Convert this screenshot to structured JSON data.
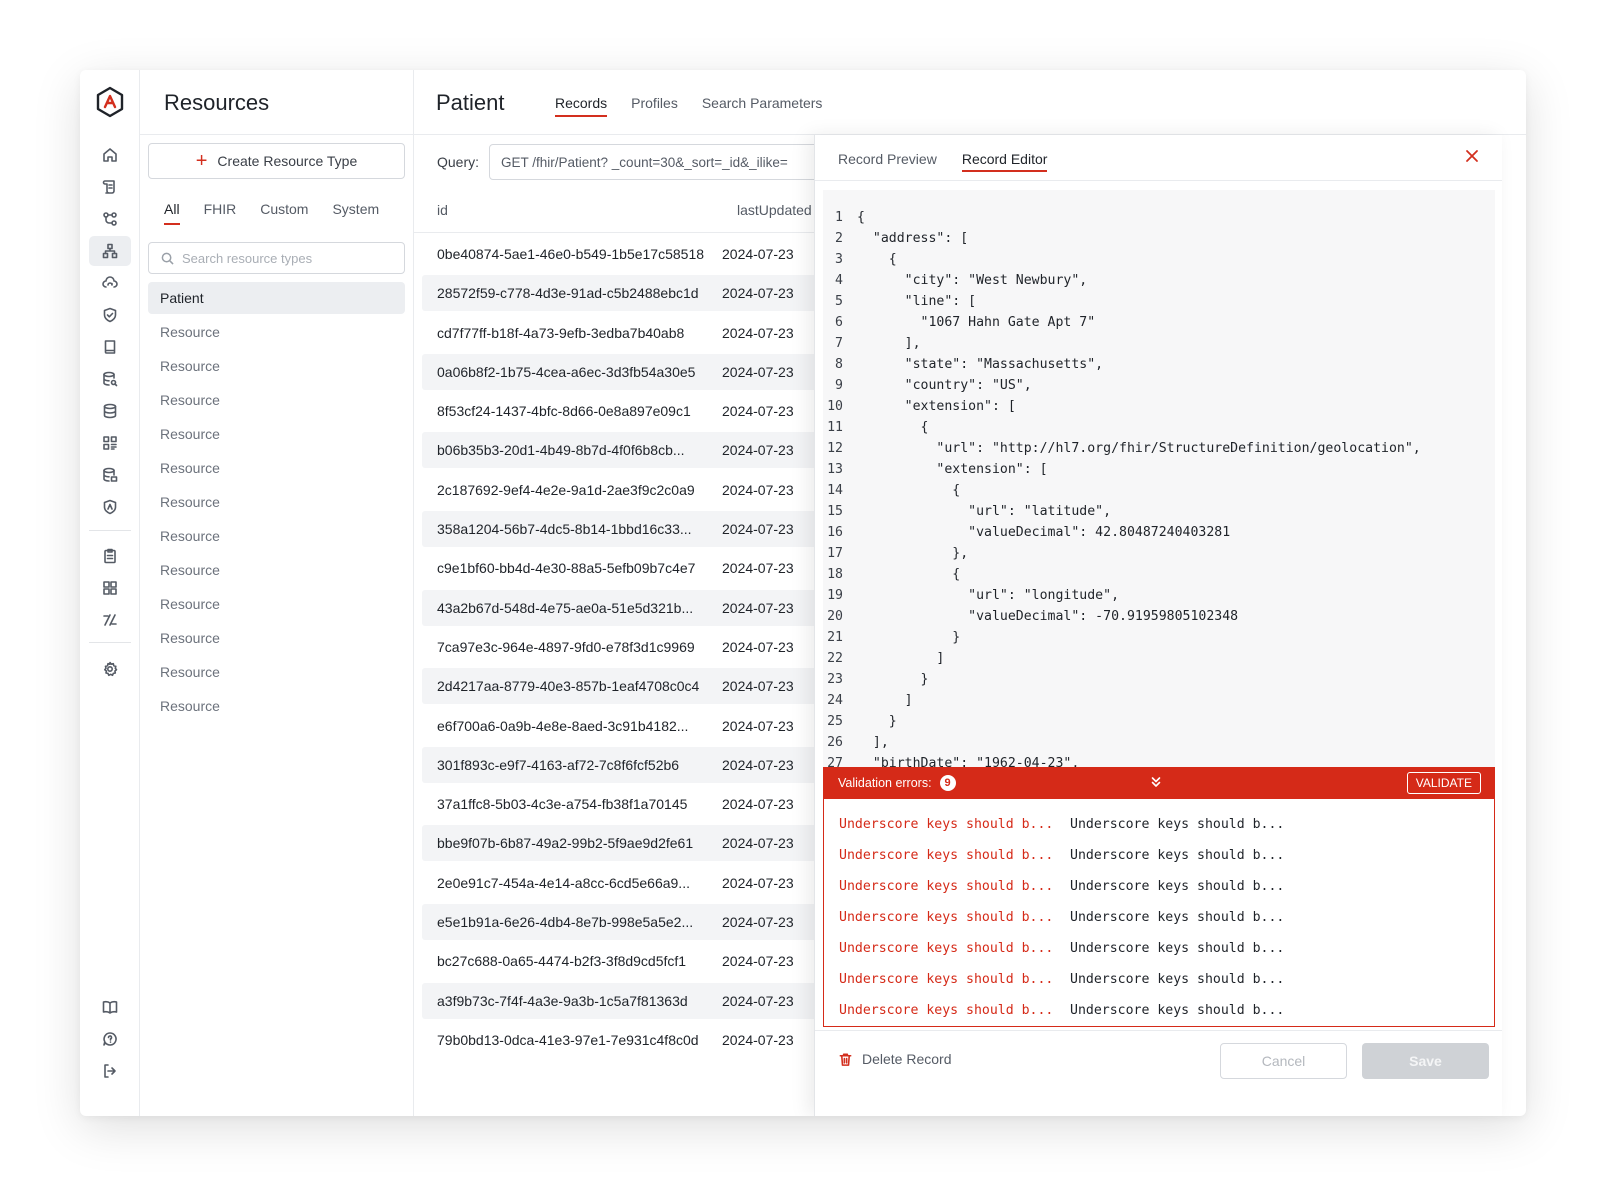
{
  "sidebar": {
    "title": "Resources",
    "create_button": "Create Resource Type",
    "filter_tabs": [
      "All",
      "FHIR",
      "Custom",
      "System"
    ],
    "search_placeholder": "Search resource types",
    "resource_types": [
      "Patient",
      "Resource",
      "Resource",
      "Resource",
      "Resource",
      "Resource",
      "Resource",
      "Resource",
      "Resource",
      "Resource",
      "Resource",
      "Resource",
      "Resource"
    ]
  },
  "rail_icons": [
    "home-icon",
    "scroll-icon",
    "flow-icon",
    "hierarchy-icon",
    "cloud-sync-icon",
    "shield-check-icon",
    "book-icon",
    "database-search-icon",
    "database-icon",
    "grid-select-icon",
    "database-settings-icon",
    "shield-logo-icon",
    "clipboard-icon",
    "apps-icon",
    "transform-icon",
    "settings-icon",
    "docs-book-icon",
    "help-chat-icon",
    "logout-icon"
  ],
  "header": {
    "title": "Patient",
    "tabs": [
      "Records",
      "Profiles",
      "Search Parameters"
    ]
  },
  "records": {
    "query_label": "Query:",
    "query_value": "GET /fhir/Patient? _count=30&_sort=_id&_ilike=",
    "columns": [
      "id",
      "lastUpdated"
    ],
    "rows": [
      {
        "id": "0be40874-5ae1-46e0-b549-1b5e17c58518",
        "updated": "2024-07-23"
      },
      {
        "id": "28572f59-c778-4d3e-91ad-c5b2488ebc1d",
        "updated": "2024-07-23"
      },
      {
        "id": "cd7f77ff-b18f-4a73-9efb-3edba7b40ab8",
        "updated": "2024-07-23"
      },
      {
        "id": "0a06b8f2-1b75-4cea-a6ec-3d3fb54a30e5",
        "updated": "2024-07-23"
      },
      {
        "id": "8f53cf24-1437-4bfc-8d66-0e8a897e09c1",
        "updated": "2024-07-23"
      },
      {
        "id": "b06b35b3-20d1-4b49-8b7d-4f0f6b8cb...",
        "updated": "2024-07-23"
      },
      {
        "id": "2c187692-9ef4-4e2e-9a1d-2ae3f9c2c0a9",
        "updated": "2024-07-23"
      },
      {
        "id": "358a1204-56b7-4dc5-8b14-1bbd16c33...",
        "updated": "2024-07-23"
      },
      {
        "id": "c9e1bf60-bb4d-4e30-88a5-5efb09b7c4e7",
        "updated": "2024-07-23"
      },
      {
        "id": "43a2b67d-548d-4e75-ae0a-51e5d321b...",
        "updated": "2024-07-23"
      },
      {
        "id": "7ca97e3c-964e-4897-9fd0-e78f3d1c9969",
        "updated": "2024-07-23"
      },
      {
        "id": "2d4217aa-8779-40e3-857b-1eaf4708c0c4",
        "updated": "2024-07-23"
      },
      {
        "id": "e6f700a6-0a9b-4e8e-8aed-3c91b4182...",
        "updated": "2024-07-23"
      },
      {
        "id": "301f893c-e9f7-4163-af72-7c8f6fcf52b6",
        "updated": "2024-07-23"
      },
      {
        "id": "37a1ffc8-5b03-4c3e-a754-fb38f1a70145",
        "updated": "2024-07-23"
      },
      {
        "id": "bbe9f07b-6b87-49a2-99b2-5f9ae9d2fe61",
        "updated": "2024-07-23"
      },
      {
        "id": "2e0e91c7-454a-4e14-a8cc-6cd5e66a9...",
        "updated": "2024-07-23"
      },
      {
        "id": "e5e1b91a-6e26-4db4-8e7b-998e5a5e2...",
        "updated": "2024-07-23"
      },
      {
        "id": "bc27c688-0a65-4474-b2f3-3f8d9cd5fcf1",
        "updated": "2024-07-23"
      },
      {
        "id": "a3f9b73c-7f4f-4a3e-9a3b-1c5a7f81363d",
        "updated": "2024-07-23"
      },
      {
        "id": "79b0bd13-0dca-41e3-97e1-7e931c4f8c0d",
        "updated": "2024-07-23"
      }
    ]
  },
  "editor": {
    "tabs": [
      "Record Preview",
      "Record Editor"
    ],
    "code_lines": [
      "{",
      "  \"address\": [",
      "    {",
      "      \"city\": \"West Newbury\",",
      "      \"line\": [",
      "        \"1067 Hahn Gate Apt 7\"",
      "      ],",
      "      \"state\": \"Massachusetts\",",
      "      \"country\": \"US\",",
      "      \"extension\": [",
      "        {",
      "          \"url\": \"http://hl7.org/fhir/StructureDefinition/geolocation\",",
      "          \"extension\": [",
      "            {",
      "              \"url\": \"latitude\",",
      "              \"valueDecimal\": 42.80487240403281",
      "            },",
      "            {",
      "              \"url\": \"longitude\",",
      "              \"valueDecimal\": -70.91959805102348",
      "            }",
      "          ]",
      "        }",
      "      ]",
      "    }",
      "  ],",
      "  \"birthDate\": \"1962-04-23\","
    ],
    "validation_label": "Validation errors:",
    "validation_count": "9",
    "validate_button": "VALIDATE",
    "errors": [
      {
        "message": "Underscore keys should b...",
        "detail": "Underscore keys should b..."
      },
      {
        "message": "Underscore keys should b...",
        "detail": "Underscore keys should b..."
      },
      {
        "message": "Underscore keys should b...",
        "detail": "Underscore keys should b..."
      },
      {
        "message": "Underscore keys should b...",
        "detail": "Underscore keys should b..."
      },
      {
        "message": "Underscore keys should b...",
        "detail": "Underscore keys should b..."
      },
      {
        "message": "Underscore keys should b...",
        "detail": "Underscore keys should b..."
      },
      {
        "message": "Underscore keys should b...",
        "detail": "Underscore keys should b..."
      }
    ],
    "delete_button": "Delete Record",
    "cancel_button": "Cancel",
    "save_button": "Save"
  },
  "colors": {
    "accent": "#d32f1e",
    "error_bar": "#d52a18",
    "selected_bg": "#eceef1"
  }
}
